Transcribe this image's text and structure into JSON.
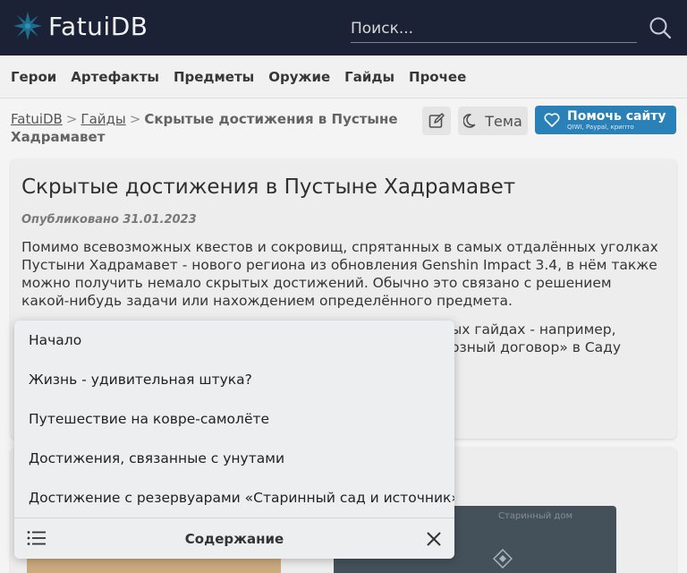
{
  "header": {
    "logo_text": "FatuiDB",
    "search_placeholder": "Поиск..."
  },
  "nav": [
    "Герои",
    "Артефакты",
    "Предметы",
    "Оружие",
    "Гайды",
    "Прочее"
  ],
  "breadcrumb": {
    "home": "FatuiDB",
    "section": "Гайды",
    "separator": ">",
    "current": "Скрытые достижения в Пустыне Хадрамавет"
  },
  "actions": {
    "theme_label": "Тема",
    "donate_title": "Помочь сайту",
    "donate_subtitle": "QIWI, Paypal, крипто"
  },
  "article": {
    "title": "Скрытые достижения в Пустыне Хадрамавет",
    "published": "Опубликовано 31.01.2023",
    "paragraph1": "Помимо всевозможных квестов и сокровищ, спрятанных в самых отдалённых уголках Пустыни Хадрамавет - нового региона из обновления Genshin Impact 3.4, в нём также можно получить немало скрытых достижений. Обычно это связано с решением какой-нибудь задачи или нахождением определённого предмета.",
    "paragraph2_line1": "ых гайдах - например,",
    "paragraph2_line2": "озный договор» в Саду",
    "map_label": "Старинный дом"
  },
  "toc": {
    "items": [
      "Начало",
      "Жизнь - удивительная штука?",
      "Путешествие на ковре-самолёте",
      "Достижения, связанные с унутами",
      "Достижение с резервуарами «Старинный сад и источник»"
    ],
    "footer_title": "Содержание"
  },
  "colors": {
    "header_bg": "#1c2236",
    "accent": "#1d7ab3",
    "logo_star": "#1e6f8e"
  }
}
